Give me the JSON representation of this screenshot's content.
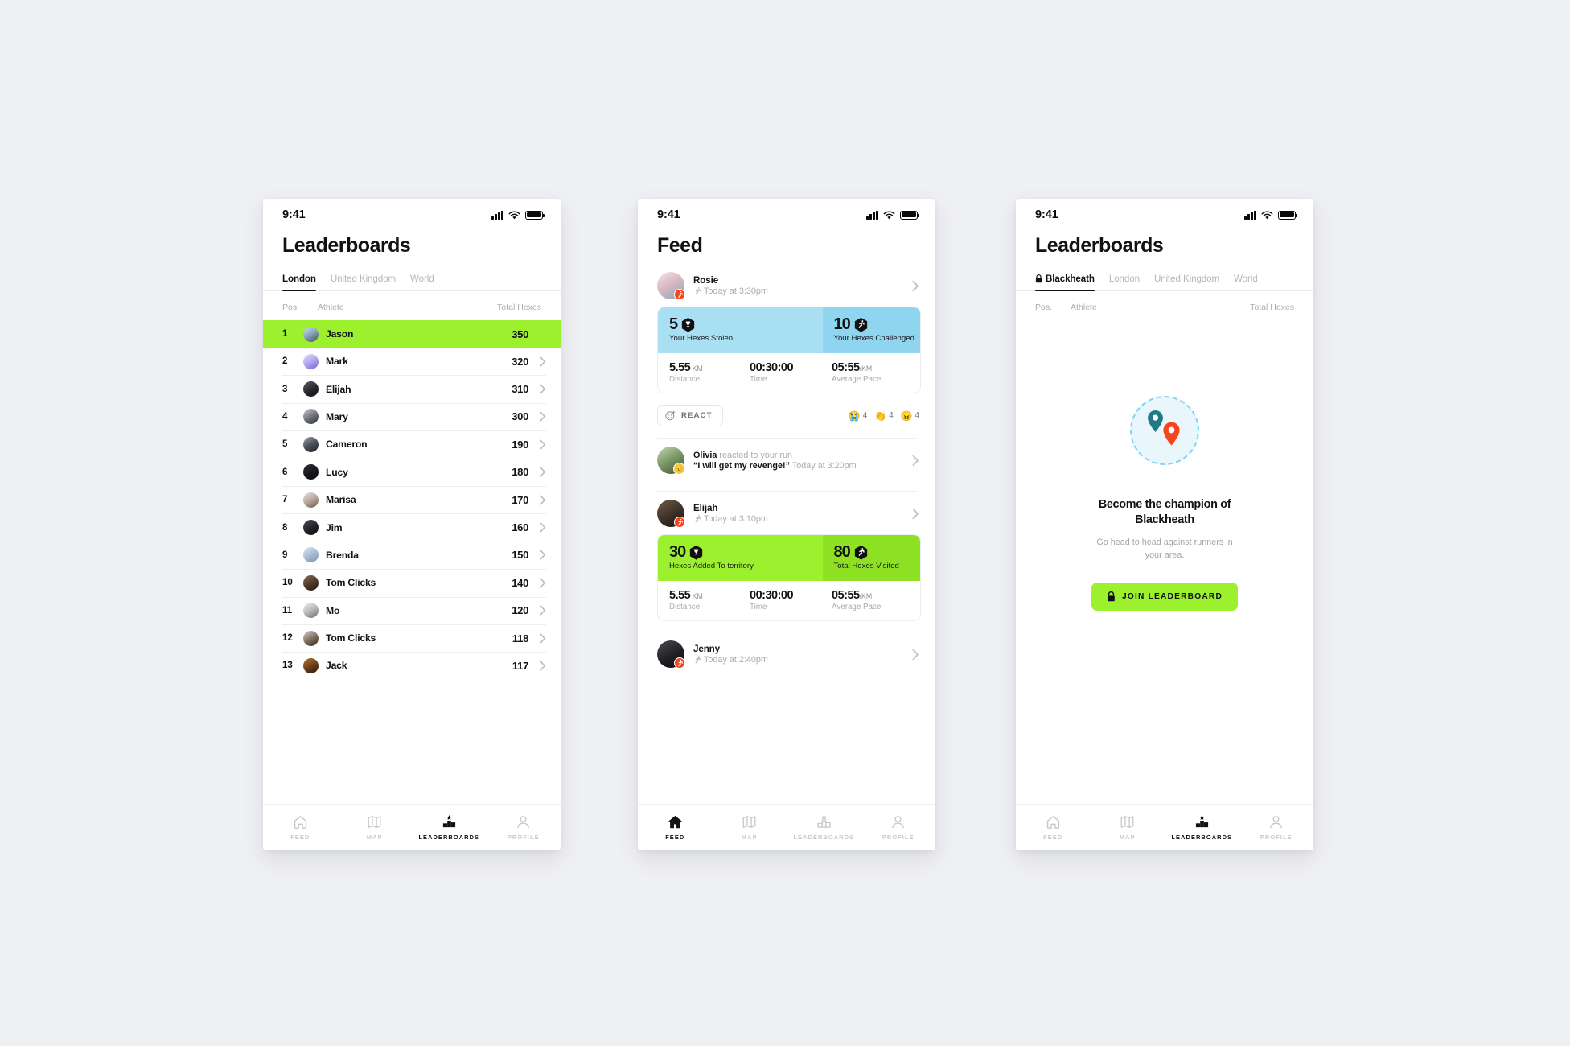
{
  "status_bar": {
    "time": "9:41",
    "signal_icon": "cellular-bars-icon",
    "wifi_icon": "wifi-icon",
    "battery_icon": "battery-full-icon"
  },
  "colors": {
    "accent_green": "#9CF02E",
    "accent_green_dark": "#8EE022",
    "card_blue": "#A8DFF3",
    "card_blue_dark": "#90D5EF",
    "badge_orange": "#F4451E",
    "pin_teal": "#1F7A85",
    "pin_red": "#F4451E",
    "illustration_bg": "#E9F7FD",
    "illustration_border": "#7ED4F2",
    "text_primary": "#111214",
    "text_muted": "#A9ACB2",
    "page_bg": "#EFF0F3"
  },
  "nav": {
    "items": [
      {
        "label": "FEED",
        "icon": "home-icon"
      },
      {
        "label": "MAP",
        "icon": "map-icon"
      },
      {
        "label": "LEADERBOARDS",
        "icon": "podium-star-icon"
      },
      {
        "label": "PROFILE",
        "icon": "person-icon"
      }
    ]
  },
  "screen1": {
    "title": "Leaderboards",
    "active_nav": "LEADERBOARDS",
    "tabs": [
      {
        "label": "London",
        "active": true,
        "locked": false
      },
      {
        "label": "United Kingdom",
        "active": false,
        "locked": false
      },
      {
        "label": "World",
        "active": false,
        "locked": false
      }
    ],
    "columns": {
      "pos": "Pos.",
      "athlete": "Athlete",
      "hexes": "Total Hexes"
    },
    "rows": [
      {
        "pos": "1",
        "name": "Jason",
        "hexes": "350",
        "highlight": true,
        "chevron": false,
        "avatar": "avatar-jason"
      },
      {
        "pos": "2",
        "name": "Mark",
        "hexes": "320",
        "highlight": false,
        "chevron": true,
        "avatar": "avatar-mark"
      },
      {
        "pos": "3",
        "name": "Elijah",
        "hexes": "310",
        "highlight": false,
        "chevron": true,
        "avatar": "avatar-elijah"
      },
      {
        "pos": "4",
        "name": "Mary",
        "hexes": "300",
        "highlight": false,
        "chevron": true,
        "avatar": "avatar-mary"
      },
      {
        "pos": "5",
        "name": "Cameron",
        "hexes": "190",
        "highlight": false,
        "chevron": true,
        "avatar": "avatar-cameron"
      },
      {
        "pos": "6",
        "name": "Lucy",
        "hexes": "180",
        "highlight": false,
        "chevron": true,
        "avatar": "avatar-lucy"
      },
      {
        "pos": "7",
        "name": "Marisa",
        "hexes": "170",
        "highlight": false,
        "chevron": true,
        "avatar": "avatar-marisa"
      },
      {
        "pos": "8",
        "name": "Jim",
        "hexes": "160",
        "highlight": false,
        "chevron": true,
        "avatar": "avatar-jim"
      },
      {
        "pos": "9",
        "name": "Brenda",
        "hexes": "150",
        "highlight": false,
        "chevron": true,
        "avatar": "avatar-brenda"
      },
      {
        "pos": "10",
        "name": "Tom Clicks",
        "hexes": "140",
        "highlight": false,
        "chevron": true,
        "avatar": "avatar-tom-1"
      },
      {
        "pos": "11",
        "name": "Mo",
        "hexes": "120",
        "highlight": false,
        "chevron": true,
        "avatar": "avatar-mo"
      },
      {
        "pos": "12",
        "name": "Tom Clicks",
        "hexes": "118",
        "highlight": false,
        "chevron": true,
        "avatar": "avatar-tom-2"
      },
      {
        "pos": "13",
        "name": "Jack",
        "hexes": "117",
        "highlight": false,
        "chevron": true,
        "avatar": "avatar-jack"
      }
    ]
  },
  "screen2": {
    "title": "Feed",
    "active_nav": "FEED",
    "posts": [
      {
        "type": "run",
        "author": "Rosie",
        "timestamp": "Today at 3:30pm",
        "activity_icon": "running-icon",
        "theme": "blue",
        "stat_left": {
          "value": "5",
          "caption": "Your Hexes Stolen",
          "icon": "hex-trophy-icon"
        },
        "stat_right": {
          "value": "10",
          "caption": "Your Hexes Challenged",
          "icon": "hex-runner-icon"
        },
        "metrics": [
          {
            "value": "5.55",
            "unit": "KM",
            "label": "Distance"
          },
          {
            "value": "00:30:00",
            "unit": "",
            "label": "Time"
          },
          {
            "value": "05:55",
            "unit": "/KM",
            "label": "Average Pace"
          }
        ],
        "react_button": "REACT",
        "reactions": [
          {
            "emoji": "😭",
            "count": "4"
          },
          {
            "emoji": "👏",
            "count": "4"
          },
          {
            "emoji": "😠",
            "count": "4"
          }
        ]
      },
      {
        "type": "reaction",
        "author": "Olivia",
        "action": " reacted to your run",
        "quote": "“I will get my revenge!”",
        "timestamp": "Today at 3:20pm",
        "badge_emoji": "😠"
      },
      {
        "type": "run",
        "author": "Elijah",
        "timestamp": "Today at 3:10pm",
        "activity_icon": "running-icon",
        "theme": "green",
        "stat_left": {
          "value": "30",
          "caption": "Hexes Added To territory",
          "icon": "hex-trophy-icon"
        },
        "stat_right": {
          "value": "80",
          "caption": "Total Hexes Visited",
          "icon": "hex-runner-icon"
        },
        "metrics": [
          {
            "value": "5.55",
            "unit": "KM",
            "label": "Distance"
          },
          {
            "value": "00:30:00",
            "unit": "",
            "label": "Time"
          },
          {
            "value": "05:55",
            "unit": "/KM",
            "label": "Average Pace"
          }
        ]
      },
      {
        "type": "header-only",
        "author": "Jenny",
        "timestamp": "Today at 2:40pm",
        "activity_icon": "running-icon"
      }
    ]
  },
  "screen3": {
    "title": "Leaderboards",
    "active_nav": "LEADERBOARDS",
    "tabs": [
      {
        "label": "Blackheath",
        "active": true,
        "locked": true
      },
      {
        "label": "London",
        "active": false,
        "locked": false
      },
      {
        "label": "United Kingdom",
        "active": false,
        "locked": false
      },
      {
        "label": "World",
        "active": false,
        "locked": false
      }
    ],
    "columns": {
      "pos": "Pos.",
      "athlete": "Athlete",
      "hexes": "Total Hexes"
    },
    "empty_state": {
      "illustration": "map-pins-icon",
      "title": "Become the champion of Blackheath",
      "subtitle": "Go head to head against runners in your area.",
      "cta_label": "JOIN LEADERBOARD",
      "cta_icon": "lock-icon"
    }
  }
}
